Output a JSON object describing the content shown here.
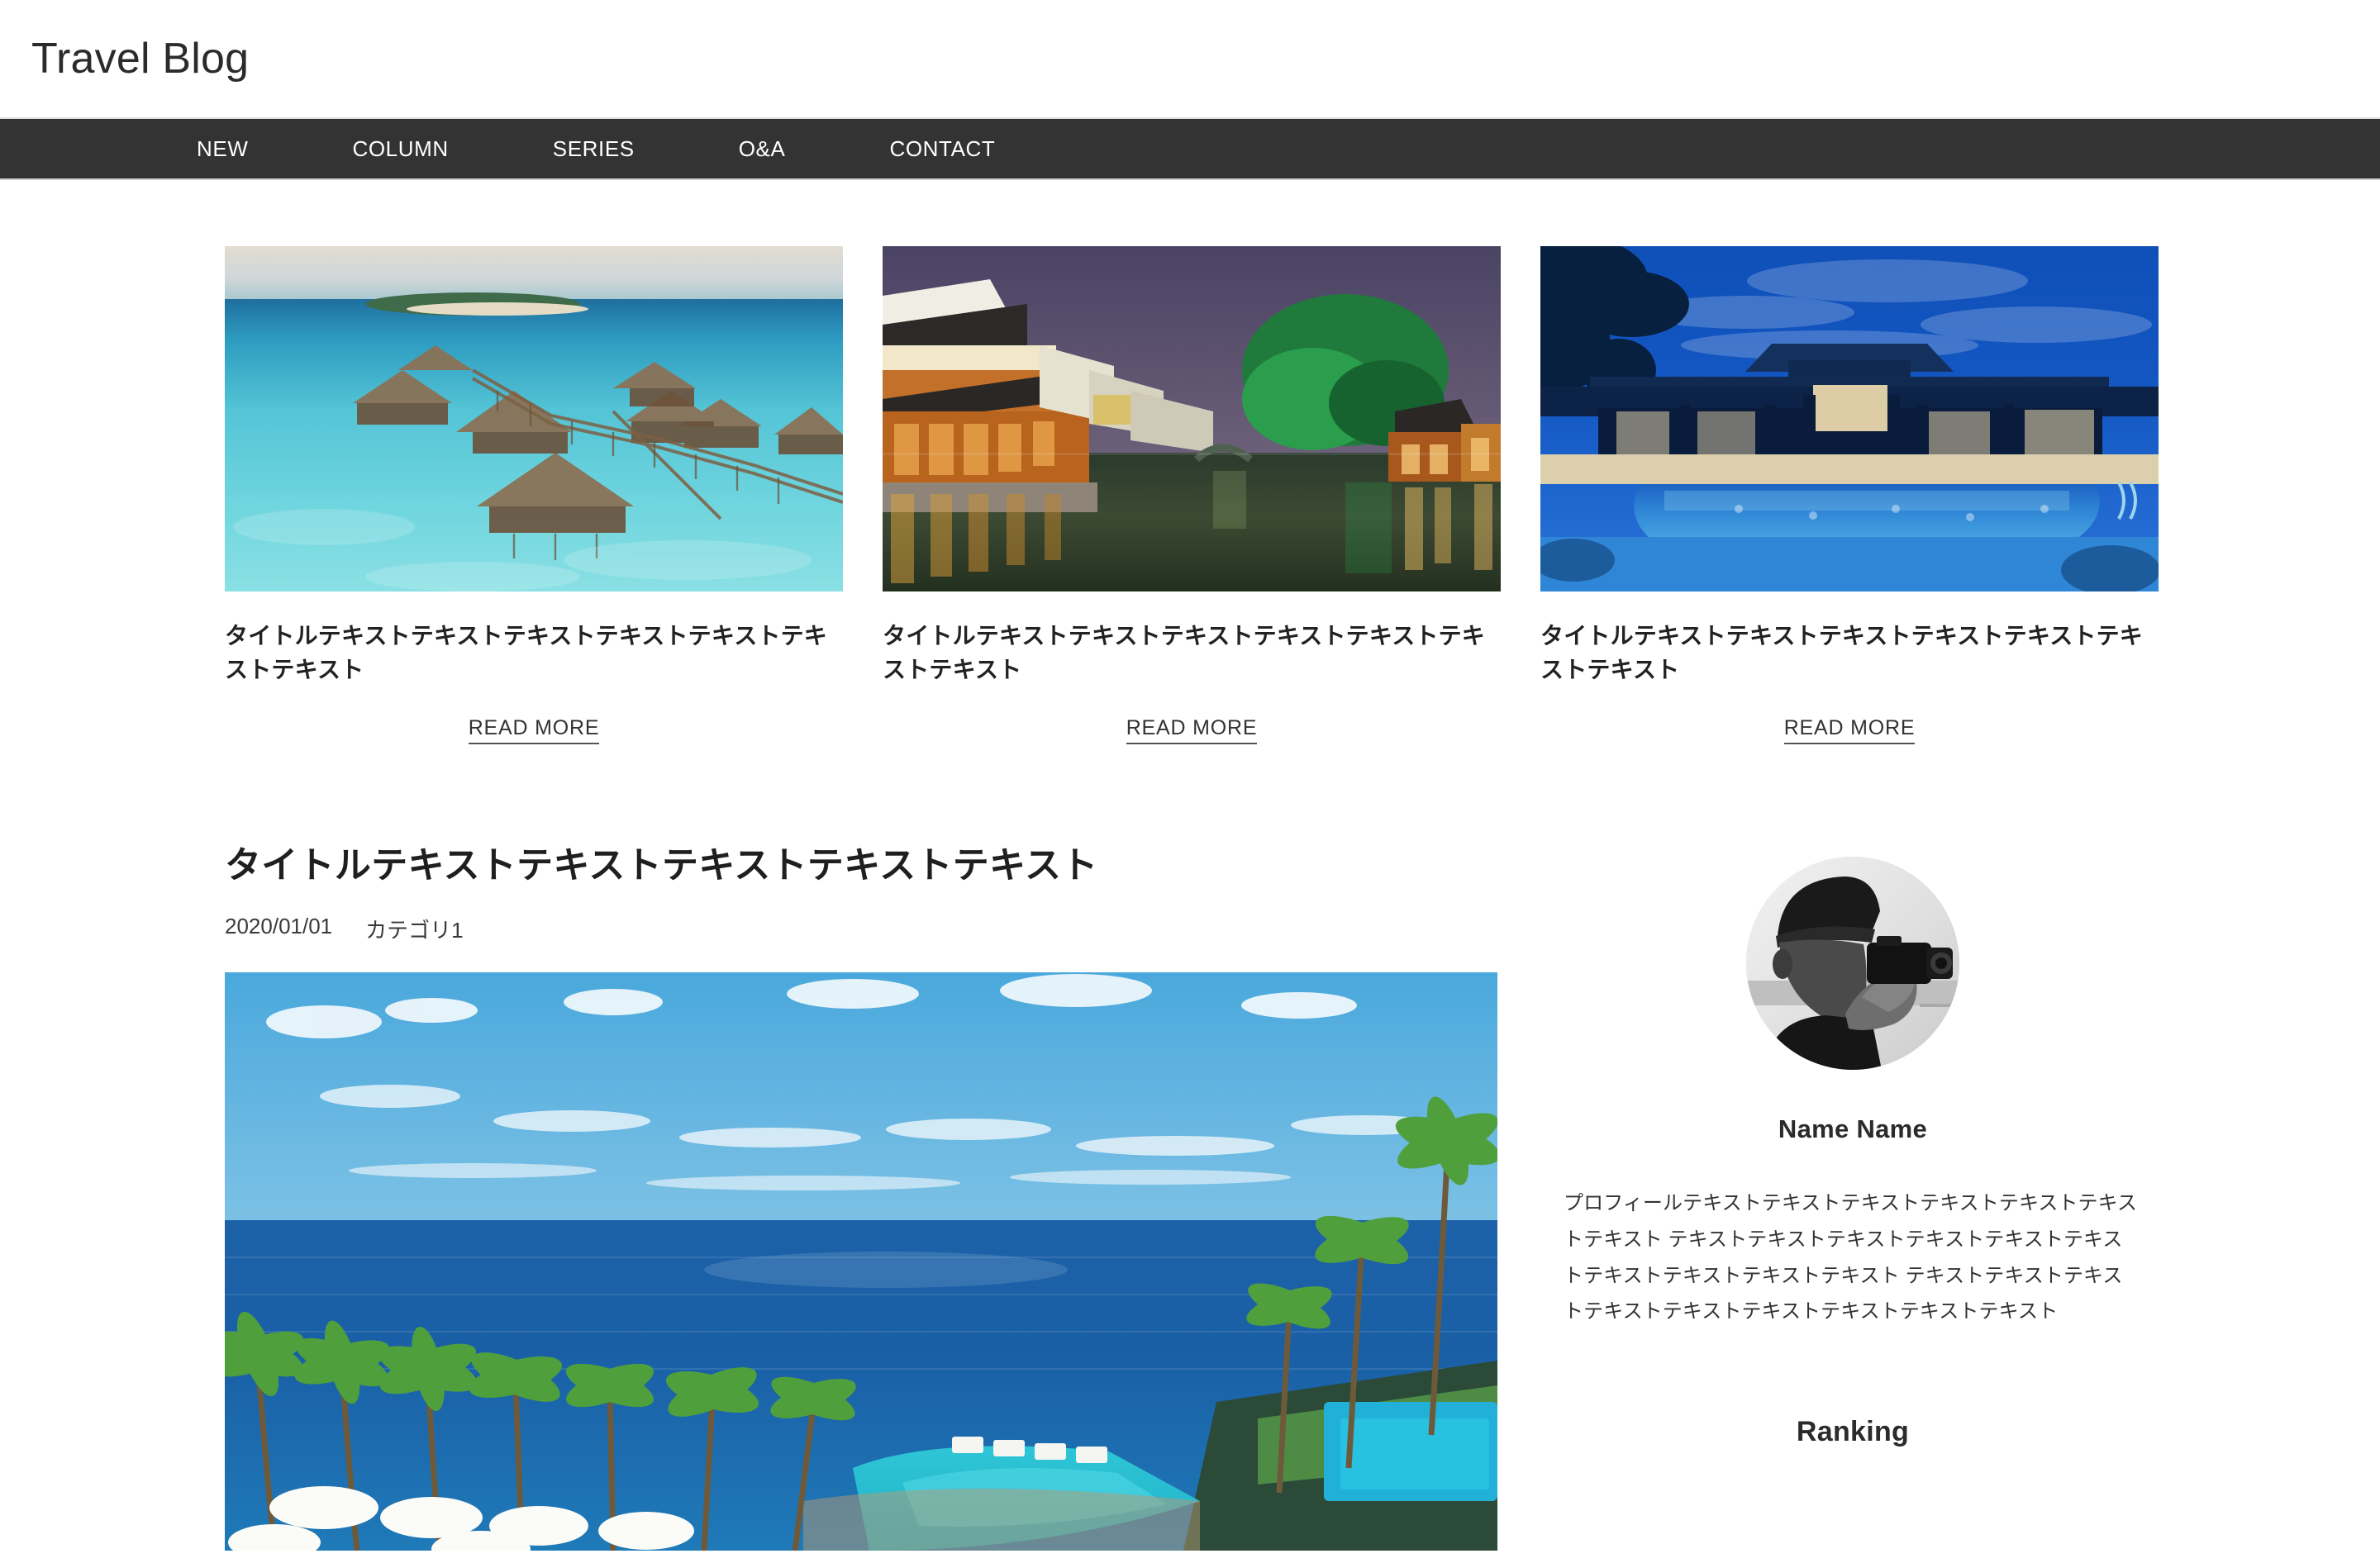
{
  "header": {
    "site_title": "Travel Blog"
  },
  "nav": {
    "items": [
      {
        "label": "NEW"
      },
      {
        "label": "COLUMN"
      },
      {
        "label": "SERIES"
      },
      {
        "label": "O&A"
      },
      {
        "label": "CONTACT"
      }
    ]
  },
  "featured": {
    "read_more_label": "READ MORE",
    "cards": [
      {
        "title": "タイトルテキストテキストテキストテキストテキストテキストテキスト",
        "image_name": "overwater-bungalows-lagoon-photo",
        "read_more_label": "READ MORE"
      },
      {
        "title": "タイトルテキストテキストテキストテキストテキストテキストテキスト",
        "image_name": "water-town-canal-night-photo",
        "read_more_label": "READ MORE"
      },
      {
        "title": "タイトルテキストテキストテキストテキストテキストテキストテキスト",
        "image_name": "resort-pool-blue-hour-photo",
        "read_more_label": "READ MORE"
      }
    ]
  },
  "article": {
    "title": "タイトルテキストテキストテキストテキストテキスト",
    "date": "2020/01/01",
    "category": "カテゴリ1",
    "image_name": "cliffside-resort-ocean-palms-photo"
  },
  "sidebar": {
    "avatar_name": "photographer-with-camera-portrait",
    "profile_name": "Name Name",
    "profile_text": "プロフィールテキストテキストテキストテキストテキストテキストテキスト テキストテキストテキストテキストテキストテキストテキストテキストテキストテキスト テキストテキストテキストテキストテキストテキストテキストテキストテキスト",
    "ranking_heading": "Ranking"
  },
  "colors": {
    "nav_background": "#333333",
    "page_background": "#ffffff",
    "text_primary": "#333333",
    "heading": "#1f1f1f",
    "nav_text": "#ffffff",
    "divider": "#e0e0e0"
  }
}
